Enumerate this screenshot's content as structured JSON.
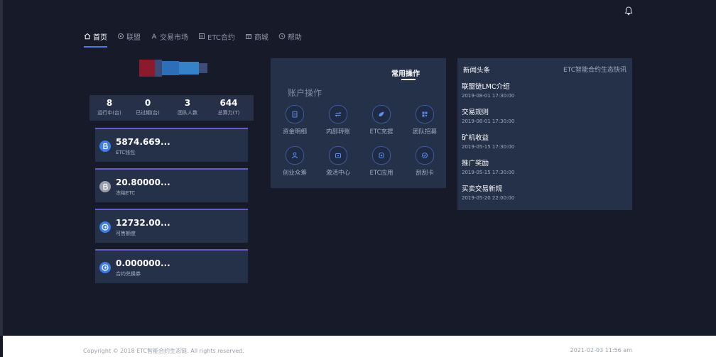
{
  "nav": {
    "items": [
      {
        "label": "首页",
        "icon": "home-icon",
        "active": true
      },
      {
        "label": "联盟",
        "icon": "alliance-icon"
      },
      {
        "label": "交易市场",
        "icon": "market-icon"
      },
      {
        "label": "ETC合约",
        "icon": "contract-icon"
      },
      {
        "label": "商城",
        "icon": "mall-icon"
      },
      {
        "label": "帮助",
        "icon": "help-icon"
      }
    ]
  },
  "stats": [
    {
      "value": "8",
      "label": "运行中(台)"
    },
    {
      "value": "0",
      "label": "已过期(台)"
    },
    {
      "value": "3",
      "label": "团队人数"
    },
    {
      "value": "644",
      "label": "总算力(T)"
    }
  ],
  "wallets": [
    {
      "amount": "5874.669...",
      "label": "ETC钱包",
      "icon": "etc-coin-icon",
      "color": "#3f7de6"
    },
    {
      "amount": "20.80000...",
      "label": "冻结ETC",
      "icon": "frozen-coin-icon",
      "color": "#9aa0ab"
    },
    {
      "amount": "12732.00...",
      "label": "可售额度",
      "icon": "quota-coin-icon",
      "color": "#3f7de6"
    },
    {
      "amount": "0.000000...",
      "label": "合约兑换券",
      "icon": "voucher-coin-icon",
      "color": "#3f7de6"
    }
  ],
  "operations": {
    "tab": "常用操作",
    "title": "账户操作",
    "items": [
      {
        "label": "资金明细",
        "icon": "fund-detail-icon"
      },
      {
        "label": "内部转账",
        "icon": "transfer-icon"
      },
      {
        "label": "ETC充提",
        "icon": "deposit-icon"
      },
      {
        "label": "团队招募",
        "icon": "qrcode-icon"
      },
      {
        "label": "创业众筹",
        "icon": "crowdfund-icon"
      },
      {
        "label": "激活中心",
        "icon": "activate-icon"
      },
      {
        "label": "ETC应用",
        "icon": "app-icon"
      },
      {
        "label": "刮刮卡",
        "icon": "scratch-card-icon"
      }
    ]
  },
  "news": {
    "title": "新闻头条",
    "subtitle": "ETC智能合约生态快讯",
    "items": [
      {
        "title": "联盟链LMC介绍",
        "date": "2019-08-01 17:30:00"
      },
      {
        "title": "交易规则",
        "date": "2019-08-01 17:30:00"
      },
      {
        "title": "矿机收益",
        "date": "2019-05-15 17:30:00"
      },
      {
        "title": "推广奖励",
        "date": "2019-05-15 17:30:00"
      },
      {
        "title": "买卖交易新规",
        "date": "2019-05-20 22:00:00"
      }
    ]
  },
  "footer": {
    "copyright": "Copyright © 2018 ETC智能合约生态链. All rights reserved.",
    "datetime": "2021-02-03 11:56 am"
  }
}
